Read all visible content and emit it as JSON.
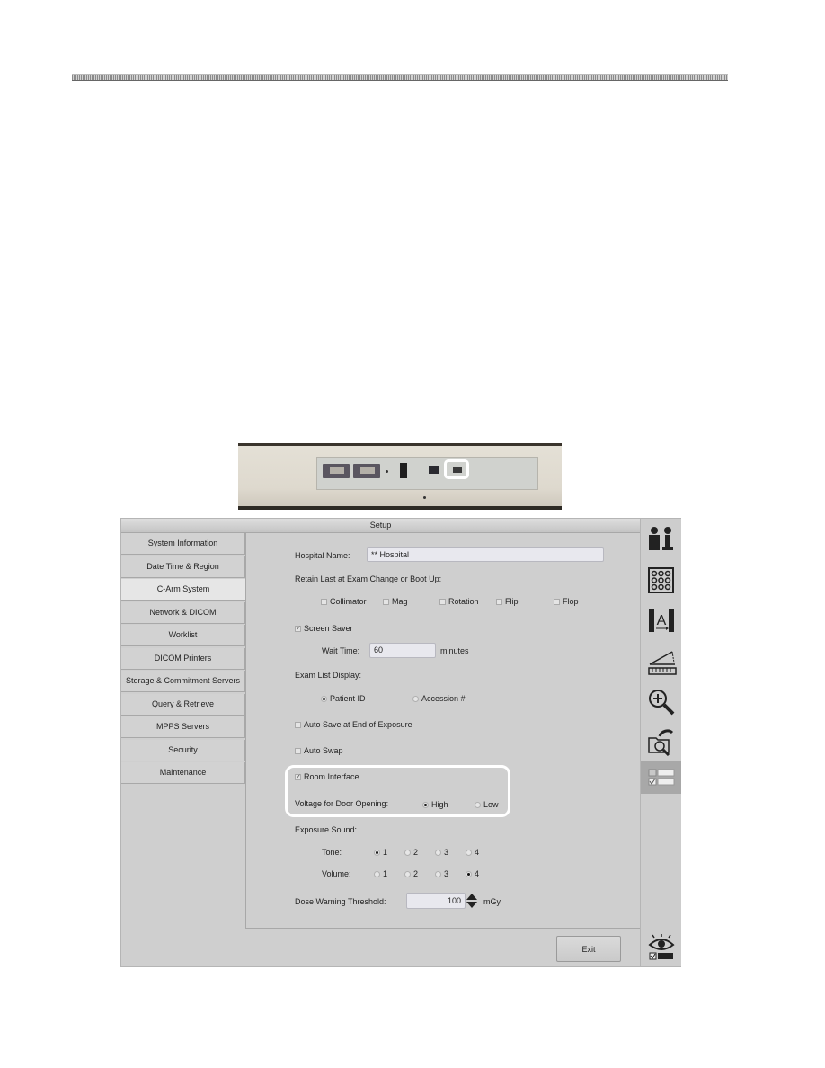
{
  "photo": {
    "caption_alt": "Connector panel with highlighted serial port"
  },
  "window": {
    "title": "Setup",
    "nav": {
      "items": [
        {
          "label": "System Information"
        },
        {
          "label": "Date Time & Region"
        },
        {
          "label": "C-Arm System",
          "active": true
        },
        {
          "label": "Network & DICOM"
        },
        {
          "label": "Worklist"
        },
        {
          "label": "DICOM Printers"
        },
        {
          "label": "Storage & Commitment Servers"
        },
        {
          "label": "Query & Retrieve"
        },
        {
          "label": "MPPS Servers"
        },
        {
          "label": "Security"
        },
        {
          "label": "Maintenance"
        }
      ]
    },
    "form": {
      "hospital_name_label": "Hospital Name:",
      "hospital_name_value": "** Hospital",
      "retain_label": "Retain Last at Exam Change or Boot Up:",
      "retain_options": [
        {
          "label": "Collimator",
          "checked": false
        },
        {
          "label": "Mag",
          "checked": false
        },
        {
          "label": "Rotation",
          "checked": false
        },
        {
          "label": "Flip",
          "checked": false
        },
        {
          "label": "Flop",
          "checked": false
        }
      ],
      "screen_saver": {
        "label": "Screen Saver",
        "checked": true
      },
      "wait_time_label": "Wait Time:",
      "wait_time_value": "60",
      "wait_time_unit": "minutes",
      "exam_list_label": "Exam List Display:",
      "exam_list_options": [
        {
          "label": "Patient ID",
          "selected": true
        },
        {
          "label": "Accession #",
          "selected": false
        }
      ],
      "auto_save": {
        "label": "Auto Save at End of Exposure",
        "checked": false
      },
      "auto_swap": {
        "label": "Auto Swap",
        "checked": false
      },
      "room_interface": {
        "label": "Room Interface",
        "checked": true
      },
      "voltage_label": "Voltage for Door Opening:",
      "voltage_options": [
        {
          "label": "High",
          "selected": true
        },
        {
          "label": "Low",
          "selected": false
        }
      ],
      "exposure_sound_label": "Exposure Sound:",
      "tone_label": "Tone:",
      "tone_options": [
        {
          "label": "1",
          "selected": true
        },
        {
          "label": "2",
          "selected": false
        },
        {
          "label": "3",
          "selected": false
        },
        {
          "label": "4",
          "selected": false
        }
      ],
      "volume_label": "Volume:",
      "volume_options": [
        {
          "label": "1",
          "selected": false
        },
        {
          "label": "2",
          "selected": false
        },
        {
          "label": "3",
          "selected": false
        },
        {
          "label": "4",
          "selected": true
        }
      ],
      "dose_label": "Dose Warning Threshold:",
      "dose_value": "100",
      "dose_unit": "mGy"
    },
    "exit_label": "Exit",
    "toolbar": [
      {
        "icon": "patient-icon"
      },
      {
        "icon": "image-grid-icon"
      },
      {
        "icon": "annotation-icon"
      },
      {
        "icon": "measure-icon"
      },
      {
        "icon": "zoom-icon"
      },
      {
        "icon": "image-browse-icon"
      },
      {
        "icon": "setup-icon",
        "active": true
      },
      {
        "icon": "view-options-icon"
      }
    ]
  }
}
